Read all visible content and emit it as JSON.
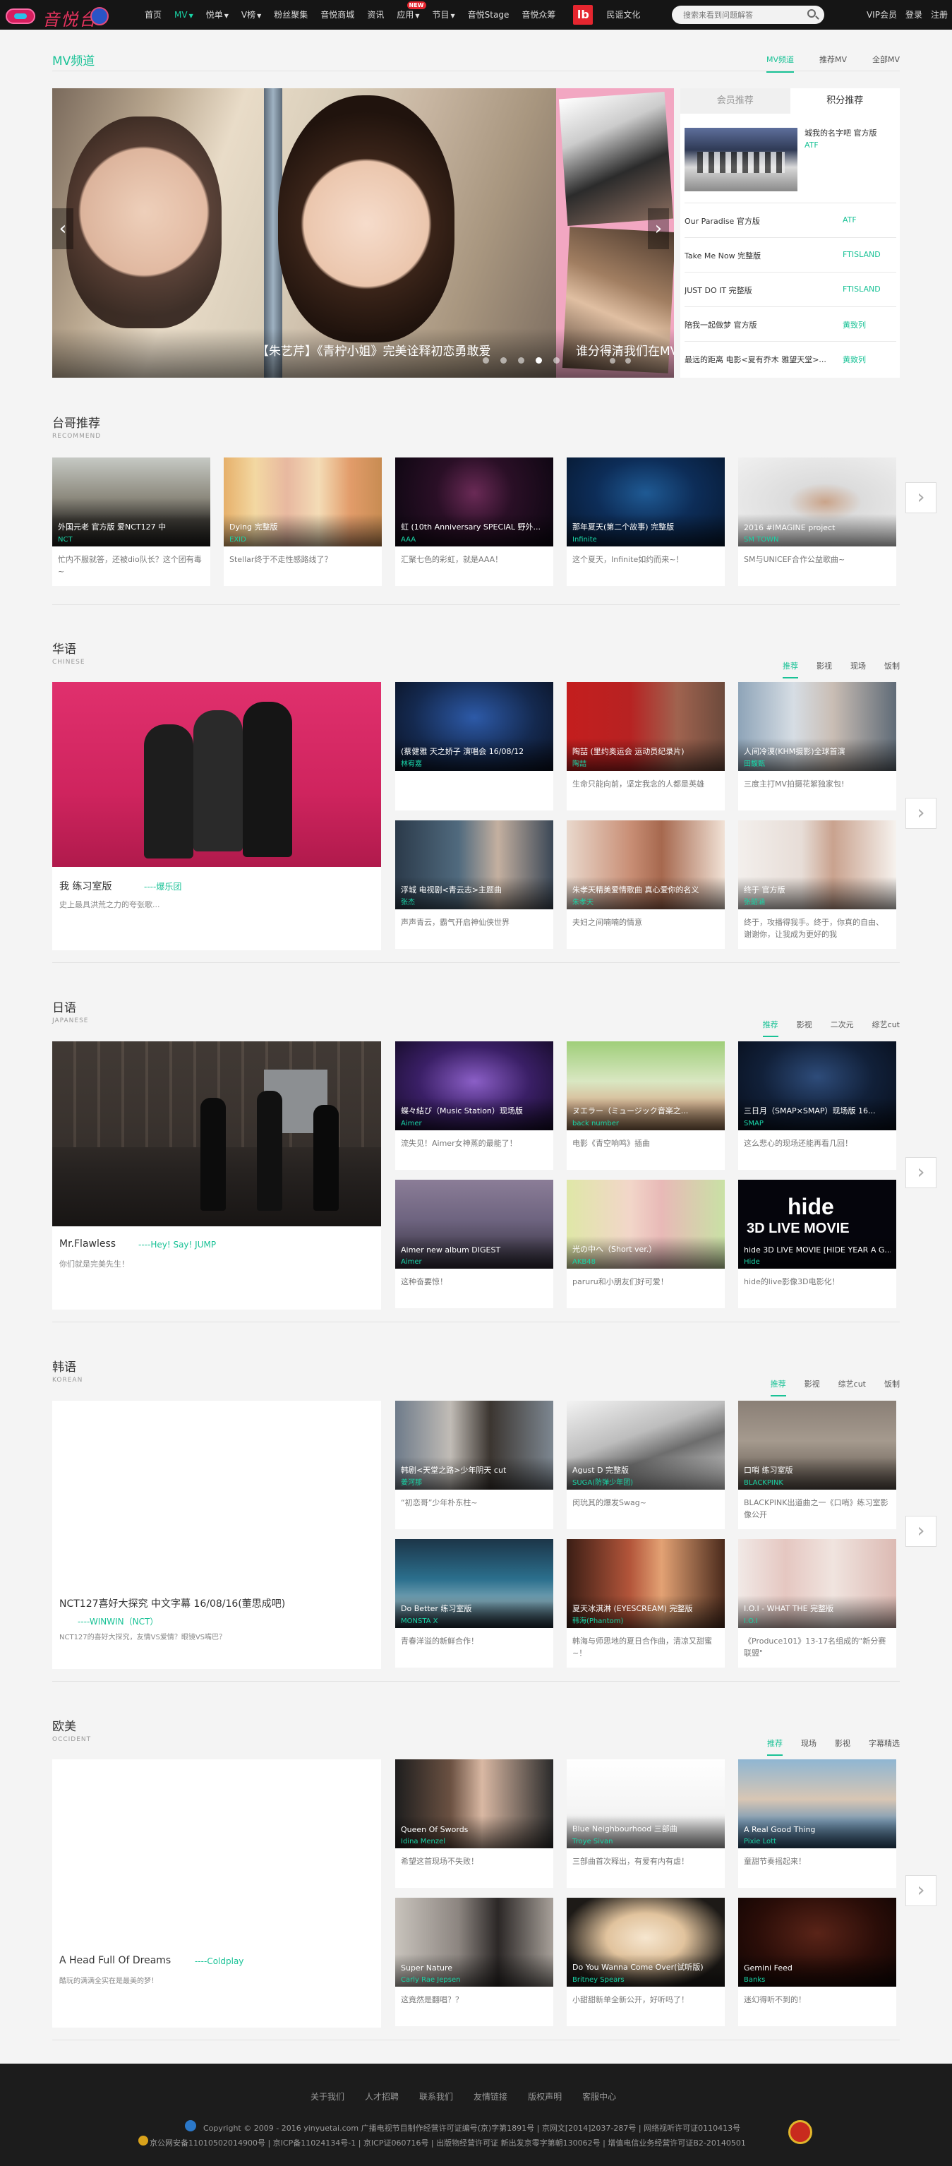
{
  "nav": {
    "brand": "音悦台",
    "items": [
      {
        "label": "首页"
      },
      {
        "label": "MV",
        "active": true,
        "caret": true
      },
      {
        "label": "悦单",
        "caret": true
      },
      {
        "label": "V榜",
        "caret": true
      },
      {
        "label": "粉丝聚集"
      },
      {
        "label": "音悦商城"
      },
      {
        "label": "资讯"
      },
      {
        "label": "应用",
        "caret": true,
        "badge": "NEW"
      },
      {
        "label": "节目",
        "caret": true
      },
      {
        "label": "音悦Stage"
      },
      {
        "label": "音悦众筹"
      },
      {
        "label": "民谣文化"
      }
    ],
    "search_placeholder": "搜索来看到问题解答",
    "vip": "VIP会员",
    "login": "登录",
    "register": "注册"
  },
  "mv": {
    "title": "MV频道",
    "tabs": [
      "MV频道",
      "推荐MV",
      "全部MV"
    ],
    "slider_caption": "【朱艺芹】《青柠小姐》完美诠释初恋勇敢爱",
    "slider_caption2": "谁分得清我们在MV里",
    "rank_tabs": [
      "会员推荐",
      "积分推荐"
    ],
    "rank_top": {
      "title": "城我的名字吧 官方版",
      "artist": "ATF"
    },
    "rank_rows": [
      {
        "title": "Our Paradise 官方版",
        "artist": "ATF"
      },
      {
        "title": "Take Me Now 完整版",
        "artist": "FTISLAND"
      },
      {
        "title": "JUST DO IT 完整版",
        "artist": "FTISLAND"
      },
      {
        "title": "陪我一起做梦 官方版",
        "artist": "黄致列"
      },
      {
        "title": "最远的距离 电影<夏有乔木 雅望天堂>...",
        "artist": "黄致列"
      }
    ]
  },
  "recommend": {
    "title": "台哥推荐",
    "sub": "RECOMMEND",
    "cards": [
      {
        "title": "外国元老 官方版 爱NCT127 中",
        "artist": "NCT",
        "desc": "忙内不服就答，还被dio队长？这个团有毒~"
      },
      {
        "title": "Dying 完整版",
        "artist": "EXID",
        "desc": "Stellar终于不走性感路线了？"
      },
      {
        "title": "虹 (10th Anniversary SPECIAL 野外...",
        "artist": "AAA",
        "desc": "汇聚七色的彩虹，就是AAA！"
      },
      {
        "title": "那年夏天(第二个故事) 完整版",
        "artist": "Infinite",
        "desc": "这个夏天，Infinite如约而来~！"
      },
      {
        "title": "2016 #IMAGINE project",
        "artist": "SM TOWN",
        "desc": "SM与UNICEF合作公益歌曲~"
      }
    ]
  },
  "chinese": {
    "title": "华语",
    "sub": "CHINESE",
    "tabs": [
      "推荐",
      "影视",
      "现场",
      "饭制"
    ],
    "big": {
      "title": "我 练习室版",
      "artist": "----爆乐团",
      "desc": "史上最具洪荒之力的夸张歌..."
    },
    "cards": [
      {
        "title": "(蔡健雅 天之娇子 演唱会 16/08/12",
        "artist": "林宥嘉",
        "desc": ""
      },
      {
        "title": "陶喆 (里约奥运会 运动员纪录片)",
        "artist": "陶喆",
        "desc": "生命只能向前，坚定我念的人都是英雄"
      },
      {
        "title": "人间冷漠(KHM摄影)全球首演",
        "artist": "田馥甄",
        "desc": "三度主打MV拍摄花絮独家包!"
      },
      {
        "title": "浮城 电视剧<青云志>主题曲",
        "artist": "张杰",
        "desc": "声声青云，霸气开启神仙侠世界"
      },
      {
        "title": "朱孝天精美爱情歌曲 真心爱你的名义",
        "artist": "朱孝天",
        "desc": "夫妇之间喃喃的情意"
      },
      {
        "title": "终于 官方版",
        "artist": "张韶涵",
        "desc": "终于，攻播得我手。终于，你真的自由、谢谢你，让我成为更好的我"
      }
    ]
  },
  "japan": {
    "title": "日语",
    "sub": "JAPANESE",
    "tabs": [
      "推荐",
      "影视",
      "二次元",
      "综艺cut"
    ],
    "big": {
      "title": "Mr.Flawless",
      "artist": "----Hey! Say! JUMP",
      "desc": "你们就是完美先生！"
    },
    "cards": [
      {
        "title": "蝶々結び（Music Station）现场版",
        "artist": "Aimer",
        "desc": "流失见！Aimer女神蒸的最能了！"
      },
      {
        "title": "ヌエラー（ミュージック音楽之...",
        "artist": "back number",
        "desc": "电影《青空响鸣》插曲"
      },
      {
        "title": "三日月（SMAP×SMAP）现场版 16...",
        "artist": "SMAP",
        "desc": "这么悲心的现场还能再看几回！"
      },
      {
        "title": "Aimer new album DIGEST",
        "artist": "Aimer",
        "desc": "这种奋要惊！"
      },
      {
        "title": "光の中へ（Short ver.）",
        "artist": "AKB48",
        "desc": "paruru和小朋友们好可爱！"
      },
      {
        "title": "hide 3D LIVE MOVIE [HIDE YEAR A G...",
        "artist": "Hide",
        "desc": "hide的live影像3D电影化！"
      }
    ]
  },
  "korea": {
    "title": "韩语",
    "sub": "KOREAN",
    "tabs": [
      "推荐",
      "影视",
      "综艺cut",
      "饭制"
    ],
    "big": {
      "title": "NCT127喜好大探究 中文字幕 16/08/16(董思成吧)",
      "artist": "----WINWIN（NCT）",
      "desc": "NCT127的喜好大探究，友情VS爱情？眼镜VS嘴巴？"
    },
    "cards": [
      {
        "title": "韩剧<天堂之路>少年阴天 cut",
        "artist": "姜河那",
        "desc": "“初恋哥”少年朴东柱~"
      },
      {
        "title": "Agust D 完整版",
        "artist": "SUGA(防弹少年团)",
        "desc": "闵玧其的爆发Swag~"
      },
      {
        "title": "口哨 练习室版",
        "artist": "BLACKPINK",
        "desc": "BLACKPINK出道曲之一《口哨》练习室影像公开"
      },
      {
        "title": "Do Better 练习室版",
        "artist": "MONSTA X",
        "desc": "青春洋溢的新鲜合作！"
      },
      {
        "title": "夏天冰淇淋 (EYESCREAM) 完整版",
        "artist": "韩海(Phantom)",
        "desc": "韩海与师思地的夏日合作曲，清凉又甜蜜~！"
      },
      {
        "title": "I.O.I - WHAT THE 完整版",
        "artist": "I.O.I",
        "desc": "《Produce101》13-17名组成的\"新分赛联盟\""
      }
    ]
  },
  "western": {
    "title": "欧美",
    "sub": "OCCIDENT",
    "tabs": [
      "推荐",
      "现场",
      "影视",
      "字幕精选"
    ],
    "big": {
      "title": "A Head Full Of Dreams",
      "artist": "----Coldplay",
      "desc": "酷玩的满满全实在是最美的梦！"
    },
    "cards": [
      {
        "title": "Queen Of Swords",
        "artist": "Idina Menzel",
        "desc": "希望这首现场不失败！"
      },
      {
        "title": "Blue Neighbourhood 三部曲",
        "artist": "Troye Sivan",
        "desc": "三部曲首次释出，有爱有内有虐！"
      },
      {
        "title": "A Real Good Thing",
        "artist": "Pixie Lott",
        "desc": "童甜节奏摇起来！"
      },
      {
        "title": "Super Nature",
        "artist": "Carly Rae Jepsen",
        "desc": "这竟然是翻唱？？"
      },
      {
        "title": "Do You Wanna Come Over(试听版)",
        "artist": "Britney Spears",
        "desc": "小甜甜新单全新公开，好听吗了！"
      },
      {
        "title": "Gemini Feed",
        "artist": "Banks",
        "desc": "迷幻得听不到的！"
      }
    ]
  },
  "footer": {
    "links": [
      "关于我们",
      "人才招聘",
      "联系我们",
      "友情链接",
      "版权声明",
      "客服中心"
    ],
    "copyright": "Copyright © 2009 - 2016 yinyuetai.com 广播电视节目制作经营许可证编号(京)字第1891号 | 京网文[2014]2037-287号 | 网络视听许可证0110413号",
    "icp": "京公网安备11010502014900号 | 京ICP备11024134号-1 | 京ICP证060716号 | 出版物经营许可证 新出发京零字第朝130062号 | 增值电信业务经营许可证B2-20140501"
  },
  "colors": {
    "accent": "#19c296",
    "topbar": "#151515",
    "footer": "#1c1c1c"
  }
}
